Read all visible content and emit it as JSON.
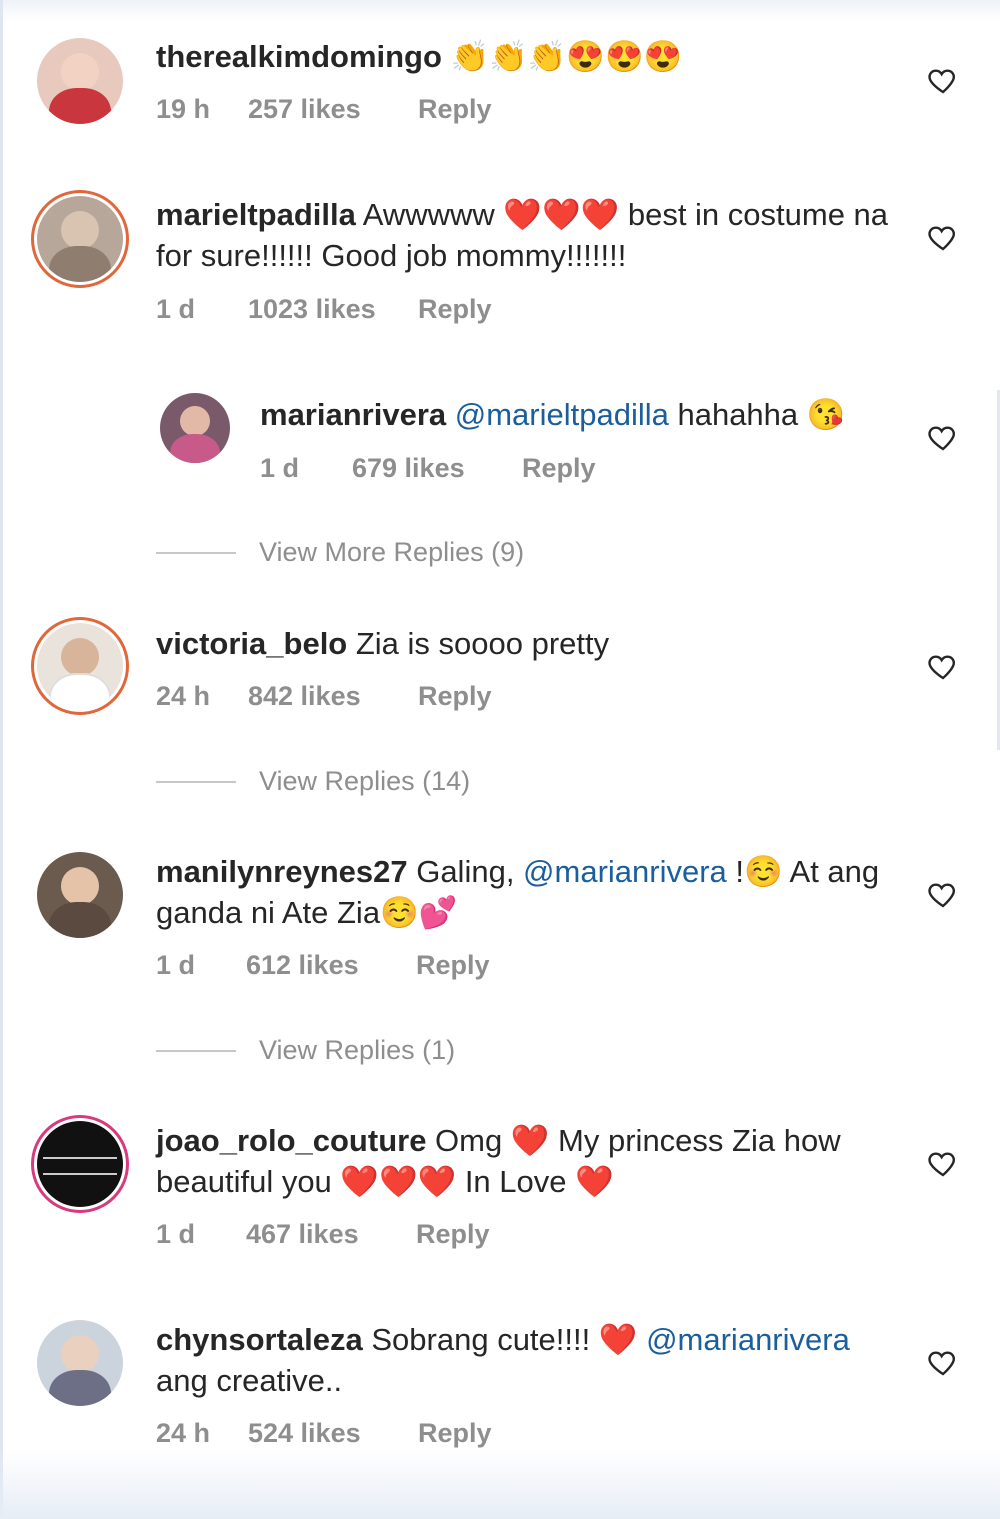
{
  "comments": [
    {
      "username": "therealkimdomingo",
      "text": " 👏👏👏😍😍😍",
      "time": "19 h",
      "likes": "257 likes",
      "reply": "Reply"
    },
    {
      "username": "marieltpadilla",
      "text": " Awwwww ❤️❤️❤️ best in costume na for sure!!!!!! Good job mommy!!!!!!!",
      "time": "1 d",
      "likes": "1023 likes",
      "reply": "Reply"
    },
    {
      "username": "marianrivera",
      "mention": "@marieltpadilla",
      "text": " hahahha 😘",
      "time": "1 d",
      "likes": "679 likes",
      "reply": "Reply"
    },
    {
      "username": "victoria_belo",
      "text": " Zia is soooo pretty",
      "time": "24 h",
      "likes": "842 likes",
      "reply": "Reply"
    },
    {
      "username": "manilynreynes27",
      "text_before": " Galing, ",
      "mention": "@marianrivera",
      "text": " !☺️ At ang ganda ni Ate Zia☺️💕",
      "time": "1 d",
      "likes": "612 likes",
      "reply": "Reply"
    },
    {
      "username": "joao_rolo_couture",
      "text": " Omg ❤️ My princess Zia how beautiful you ❤️❤️❤️ In Love ❤️",
      "time": "1 d",
      "likes": "467 likes",
      "reply": "Reply"
    },
    {
      "username": "chynsortaleza",
      "text": " Sobrang cute!!!! ❤️ ",
      "mention": "@marianrivera",
      "text_after": " ang creative..",
      "time": "24 h",
      "likes": "524 likes",
      "reply": "Reply"
    }
  ],
  "view_more_replies_1": "View More Replies (9)",
  "view_replies_2": "View Replies (14)",
  "view_replies_3": "View Replies (1)",
  "colors": {
    "username": "#262626",
    "mention": "#1b5e9c",
    "meta": "#8e8e8e",
    "story_ring": "#d9397e"
  },
  "icons": {
    "like": "heart-outline-icon"
  }
}
